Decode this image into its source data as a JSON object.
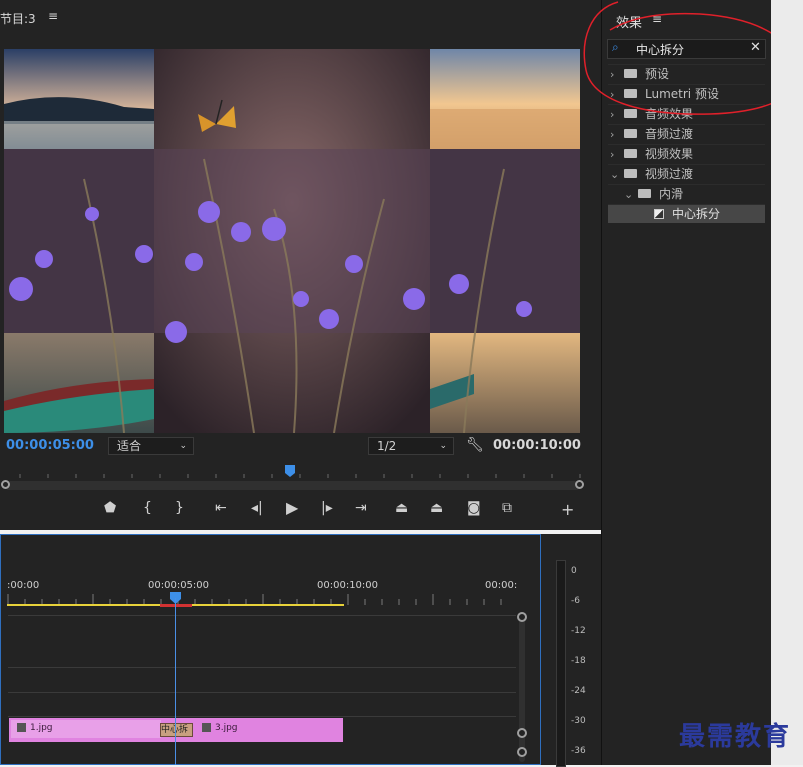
{
  "program_monitor": {
    "tab_label": "节目:3",
    "menu_icon": "hamburger-icon",
    "timecode_current": "00:00:05:00",
    "fit_option": "适合",
    "resolution_option": "1/2",
    "timecode_duration": "00:00:10:00",
    "controls": [
      "marker-icon",
      "mark-in-icon",
      "mark-out-icon",
      "go-to-in-icon",
      "step-back-icon",
      "play-icon",
      "step-forward-icon",
      "go-to-out-icon",
      "lift-icon",
      "extract-icon",
      "export-frame-icon",
      "comparison-view-icon",
      "add-button-icon"
    ]
  },
  "effects_panel": {
    "title": "效果",
    "menu_icon": "hamburger-icon",
    "search_value": "中心拆分",
    "tree": [
      {
        "label": "预设",
        "expanded": false,
        "depth": 0,
        "icon": "preset-folder-icon"
      },
      {
        "label": "Lumetri 预设",
        "expanded": false,
        "depth": 0,
        "icon": "preset-folder-icon"
      },
      {
        "label": "音频效果",
        "expanded": false,
        "depth": 0,
        "icon": "folder-icon"
      },
      {
        "label": "音频过渡",
        "expanded": false,
        "depth": 0,
        "icon": "folder-icon"
      },
      {
        "label": "视频效果",
        "expanded": false,
        "depth": 0,
        "icon": "folder-icon"
      },
      {
        "label": "视频过渡",
        "expanded": true,
        "depth": 0,
        "icon": "folder-icon"
      },
      {
        "label": "内滑",
        "expanded": true,
        "depth": 1,
        "icon": "folder-icon"
      },
      {
        "label": "中心拆分",
        "expanded": false,
        "depth": 2,
        "icon": "transition-icon",
        "selected": true
      }
    ]
  },
  "timeline": {
    "ruler_labels": [
      ":00:00",
      "00:00:05:00",
      "00:00:10:00",
      "00:00:"
    ],
    "clips": [
      {
        "name": "1.jpg"
      },
      {
        "name": "3.jpg"
      }
    ],
    "transition_label": "中心拆"
  },
  "audio_meter": {
    "db_labels": [
      "0",
      "-6",
      "-12",
      "-18",
      "-24",
      "-30",
      "-36"
    ]
  },
  "watermark": "最需教育",
  "colors": {
    "accent_blue": "#3d8fe8",
    "clip_pink": "#e083e0",
    "annotation_red": "#e0202a",
    "work_area_yellow": "#e8d23a"
  }
}
